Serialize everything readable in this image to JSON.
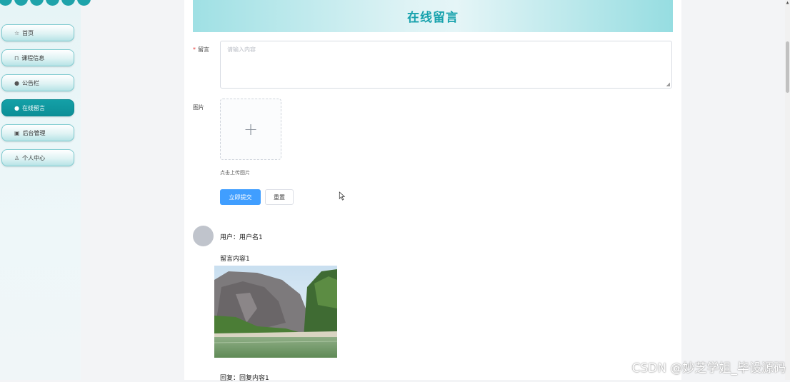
{
  "sidebar": {
    "items": [
      {
        "label": "首页",
        "icon": "star-icon",
        "active": false
      },
      {
        "label": "课程信息",
        "icon": "bag-icon",
        "active": false
      },
      {
        "label": "公告栏",
        "icon": "info-icon",
        "active": false
      },
      {
        "label": "在线留言",
        "icon": "chat-icon",
        "active": true
      },
      {
        "label": "后台管理",
        "icon": "briefcase-icon",
        "active": false
      },
      {
        "label": "个人中心",
        "icon": "user-icon",
        "active": false
      }
    ]
  },
  "page": {
    "title": "在线留言"
  },
  "form": {
    "message_label": "留言",
    "message_required_mark": "*",
    "message_placeholder": "请输入内容",
    "image_label": "图片",
    "upload_tip": "点击上传图片",
    "submit_label": "立即提交",
    "reset_label": "重置"
  },
  "comments": [
    {
      "user_line": "用户：用户名1",
      "content": "留言内容1",
      "reply_line": "回复：回复内容1"
    }
  ],
  "watermark": "CSDN @妙芝学姐_毕设源码",
  "colors": {
    "accent": "#18a2ad",
    "primary_button": "#409eff",
    "active_nav": "#0c8f97"
  }
}
